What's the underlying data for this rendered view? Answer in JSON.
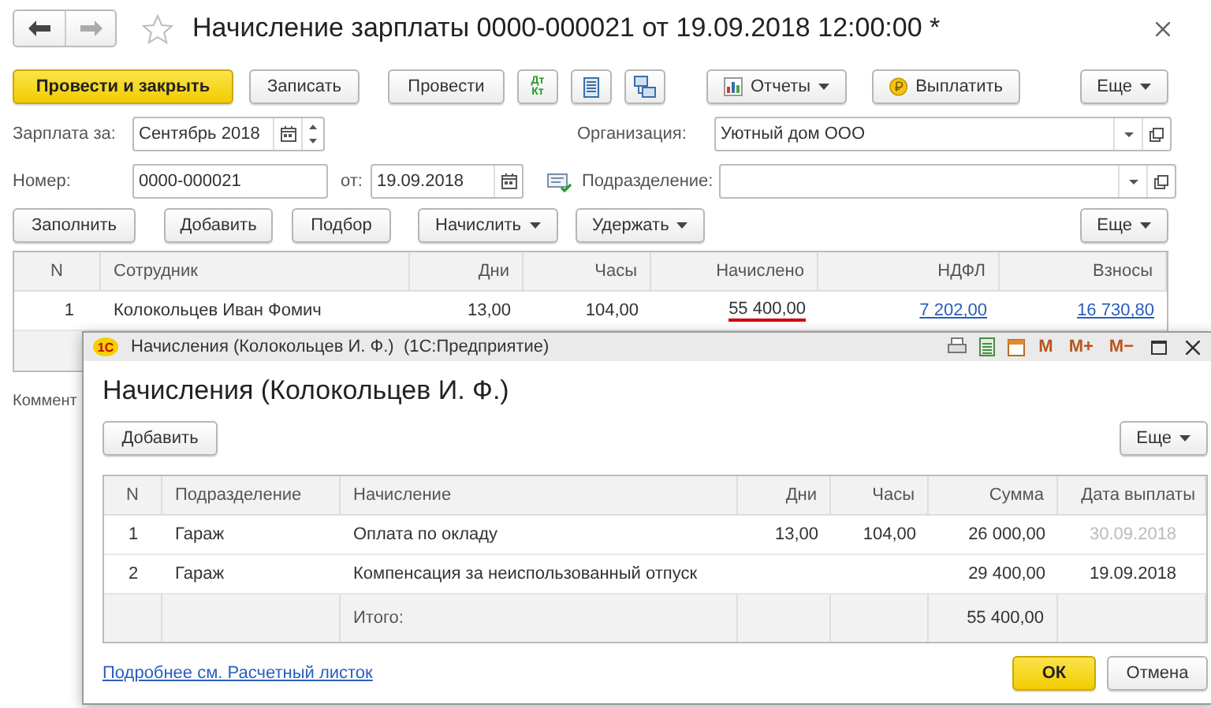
{
  "window": {
    "title": "Начисление зарплаты 0000-000021 от 19.09.2018 12:00:00 *",
    "favorite": false
  },
  "toolbar": [
    {
      "kind": "primary",
      "label": "Провести и закрыть"
    },
    {
      "kind": "plain",
      "label": "Записать"
    },
    {
      "kind": "plain",
      "label": "Провести"
    },
    {
      "kind": "dtkt",
      "label": "Дт\nКт"
    },
    {
      "kind": "list"
    },
    {
      "kind": "structure"
    },
    {
      "kind": "reports",
      "label": "Отчеты"
    },
    {
      "kind": "pay",
      "label": "Выплатить"
    },
    {
      "kind": "more",
      "label": "Еще"
    }
  ],
  "header": {
    "period": {
      "label": "Зарплата за:",
      "value": "Сентябрь 2018"
    },
    "organization": {
      "label": "Организация:",
      "value": "Уютный дом ООО"
    },
    "number": {
      "label": "Номер:",
      "value": "0000-000021"
    },
    "date": {
      "label": "от:",
      "value": "19.09.2018"
    },
    "department": {
      "label": "Подразделение:"
    }
  },
  "table_toolbar": [
    {
      "label": "Заполнить",
      "dropdown": false
    },
    {
      "label": "Добавить",
      "dropdown": false
    },
    {
      "label": "Подбор",
      "dropdown": false
    },
    {
      "label": "Начислить",
      "dropdown": true
    },
    {
      "label": "Удержать",
      "dropdown": true
    },
    {
      "label": "Еще",
      "dropdown": true
    }
  ],
  "table": {
    "columns": [
      "N",
      "Сотрудник",
      "Дни",
      "Часы",
      "Начислено",
      "НДФЛ",
      "Взносы"
    ],
    "rows": [
      {
        "n": "1",
        "employee": "Колокольцев Иван Фомич",
        "days": "13,00",
        "hours": "104,00",
        "accrued": "55 400,00",
        "ndfl": "7 202,00",
        "contributions": "16 730,80",
        "accrued_underlined": true
      }
    ]
  },
  "comment_label": "Коммент",
  "dialog": {
    "logo": "1С",
    "title": "Начисления (Колокольцев И. Ф.)  (1С:Предприятие)",
    "title_buttons": [
      "M",
      "M+",
      "M−"
    ],
    "heading": "Начисления (Колокольцев И. Ф.)",
    "add_button": "Добавить",
    "more_button": "Еще",
    "columns": [
      "N",
      "Подразделение",
      "Начисление",
      "Дни",
      "Часы",
      "Сумма",
      "Дата выплаты"
    ],
    "rows": [
      {
        "n": "1",
        "department": "Гараж",
        "accrual": "Оплата по окладу",
        "days": "13,00",
        "hours": "104,00",
        "sum": "26 000,00",
        "pay_date": "30.09.2018",
        "date_dimmed": true
      },
      {
        "n": "2",
        "department": "Гараж",
        "accrual": "Компенсация за неиспользованный отпуск",
        "sum": "29 400,00",
        "pay_date": "19.09.2018",
        "date_dimmed": false
      }
    ],
    "total_label": "Итого:",
    "total": "55 400,00",
    "link": "Подробнее см. Расчетный листок",
    "ok": "ОК",
    "cancel": "Отмена"
  }
}
